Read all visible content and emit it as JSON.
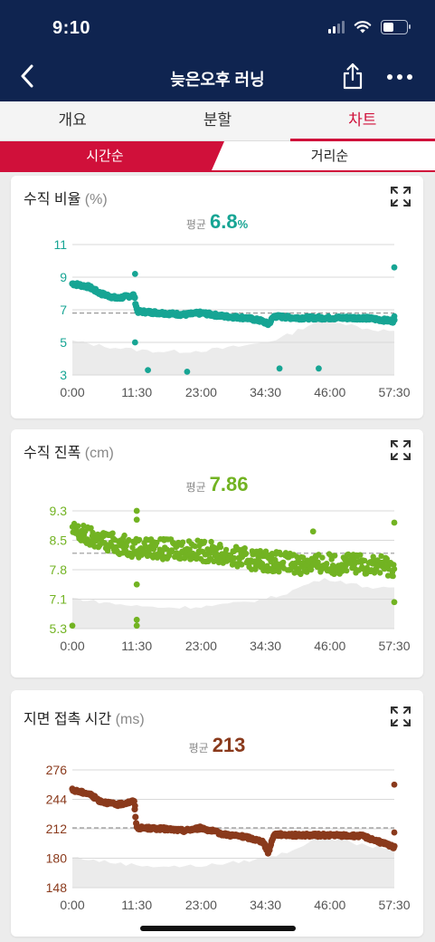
{
  "status": {
    "time": "9:10"
  },
  "header": {
    "title": "늦은오후 러닝",
    "back_icon": "chevron-left-icon",
    "share_icon": "share-icon",
    "more_icon": "more-dots-icon"
  },
  "tabs": [
    {
      "label": "개요",
      "active": false
    },
    {
      "label": "분할",
      "active": false
    },
    {
      "label": "차트",
      "active": true
    }
  ],
  "segment": {
    "left": "시간순",
    "right": "거리순",
    "active": "left"
  },
  "colors": {
    "brand_red": "#d0103a",
    "nav_bg": "#0f2450",
    "teal": "#17a594",
    "green": "#72b322",
    "brown": "#8a3a1c"
  },
  "charts": [
    {
      "title": "수직 비율",
      "unit": "(%)",
      "avg_label": "평균",
      "avg_value": "6.8",
      "avg_unit": "%",
      "color": "#17a594",
      "chart_data": {
        "type": "scatter",
        "title": "수직 비율",
        "ylabel": "%",
        "y_ticks": [
          "11",
          "9",
          "7",
          "5",
          "3"
        ],
        "ylim": [
          3,
          11
        ],
        "x_ticks": [
          "0:00",
          "11:30",
          "23:00",
          "34:30",
          "46:00",
          "57:30"
        ],
        "xlim_minutes": [
          0,
          57.5
        ],
        "average": 6.8,
        "trend": [
          [
            0,
            8.6
          ],
          [
            3,
            8.4
          ],
          [
            5,
            8.0
          ],
          [
            8,
            7.7
          ],
          [
            11,
            7.9
          ],
          [
            11.6,
            6.9
          ],
          [
            16,
            6.8
          ],
          [
            20,
            6.7
          ],
          [
            23,
            6.8
          ],
          [
            27,
            6.6
          ],
          [
            31,
            6.5
          ],
          [
            34,
            6.3
          ],
          [
            35,
            6.1
          ],
          [
            36,
            6.6
          ],
          [
            40,
            6.5
          ],
          [
            46,
            6.5
          ],
          [
            52,
            6.5
          ],
          [
            57.5,
            6.3
          ]
        ],
        "outliers": [
          [
            11.2,
            9.2
          ],
          [
            11.2,
            5.0
          ],
          [
            13.5,
            3.3
          ],
          [
            20.5,
            3.2
          ],
          [
            37,
            3.4
          ],
          [
            44,
            3.4
          ],
          [
            57.5,
            9.6
          ],
          [
            57.5,
            6.6
          ]
        ]
      }
    },
    {
      "title": "수직 진폭",
      "unit": "(cm)",
      "avg_label": "평균",
      "avg_value": "7.86",
      "avg_unit": "",
      "color": "#72b322",
      "chart_data": {
        "type": "scatter",
        "title": "수직 진폭",
        "ylabel": "cm",
        "y_ticks": [
          "9.3",
          "8.5",
          "7.8",
          "7.1",
          "5.3"
        ],
        "ylim": [
          5.3,
          9.3
        ],
        "x_ticks": [
          "0:00",
          "11:30",
          "23:00",
          "34:30",
          "46:00",
          "57:30"
        ],
        "xlim_minutes": [
          0,
          57.5
        ],
        "average": 7.86,
        "trend": [
          [
            0,
            8.6
          ],
          [
            5,
            8.3
          ],
          [
            10,
            8.1
          ],
          [
            15,
            8.0
          ],
          [
            20,
            8.0
          ],
          [
            25,
            7.9
          ],
          [
            30,
            7.7
          ],
          [
            35,
            7.6
          ],
          [
            40,
            7.5
          ],
          [
            46,
            7.5
          ],
          [
            52,
            7.5
          ],
          [
            57.5,
            7.4
          ]
        ],
        "outliers": [
          [
            11.5,
            9.3
          ],
          [
            11.5,
            9.0
          ],
          [
            11.5,
            6.8
          ],
          [
            11.5,
            5.6
          ],
          [
            11.5,
            5.4
          ],
          [
            0,
            5.4
          ],
          [
            43,
            8.6
          ],
          [
            57.5,
            8.9
          ],
          [
            57.5,
            6.2
          ]
        ]
      }
    },
    {
      "title": "지면 접촉 시간",
      "unit": "(ms)",
      "avg_label": "평균",
      "avg_value": "213",
      "avg_unit": "",
      "color": "#8a3a1c",
      "chart_data": {
        "type": "scatter",
        "title": "지면 접촉 시간",
        "ylabel": "ms",
        "y_ticks": [
          "276",
          "244",
          "212",
          "180",
          "148"
        ],
        "ylim": [
          148,
          276
        ],
        "x_ticks": [
          "0:00",
          "11:30",
          "23:00",
          "34:30",
          "46:00",
          "57:30"
        ],
        "xlim_minutes": [
          0,
          57.5
        ],
        "average": 213,
        "trend": [
          [
            0,
            254
          ],
          [
            3,
            250
          ],
          [
            5,
            242
          ],
          [
            8,
            238
          ],
          [
            11,
            242
          ],
          [
            11.5,
            213
          ],
          [
            16,
            212
          ],
          [
            20,
            210
          ],
          [
            23,
            213
          ],
          [
            27,
            206
          ],
          [
            31,
            203
          ],
          [
            34,
            198
          ],
          [
            35,
            186
          ],
          [
            36,
            206
          ],
          [
            40,
            205
          ],
          [
            46,
            205
          ],
          [
            52,
            204
          ],
          [
            57.5,
            192
          ]
        ],
        "outliers": [
          [
            11.2,
            237
          ],
          [
            57.5,
            260
          ],
          [
            57.5,
            208
          ]
        ]
      }
    }
  ]
}
